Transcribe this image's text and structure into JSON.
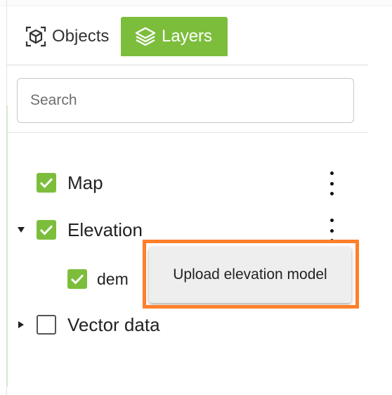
{
  "tabs": [
    {
      "label": "Objects",
      "icon": "cube-icon",
      "active": false
    },
    {
      "label": "Layers",
      "icon": "layers-icon",
      "active": true
    }
  ],
  "search": {
    "placeholder": "Search",
    "value": ""
  },
  "layers": {
    "map": {
      "label": "Map",
      "checked": true
    },
    "elevation": {
      "label": "Elevation",
      "checked": true,
      "expanded": true
    },
    "dem": {
      "label": "dem",
      "checked": true
    },
    "vector": {
      "label": "Vector data",
      "checked": false,
      "expanded": false
    }
  },
  "context_menu": {
    "item_label": "Upload elevation model"
  },
  "colors": {
    "accent": "#7cbe3c",
    "highlight": "#ff7f2a",
    "menu_bg": "#eeeeee"
  }
}
